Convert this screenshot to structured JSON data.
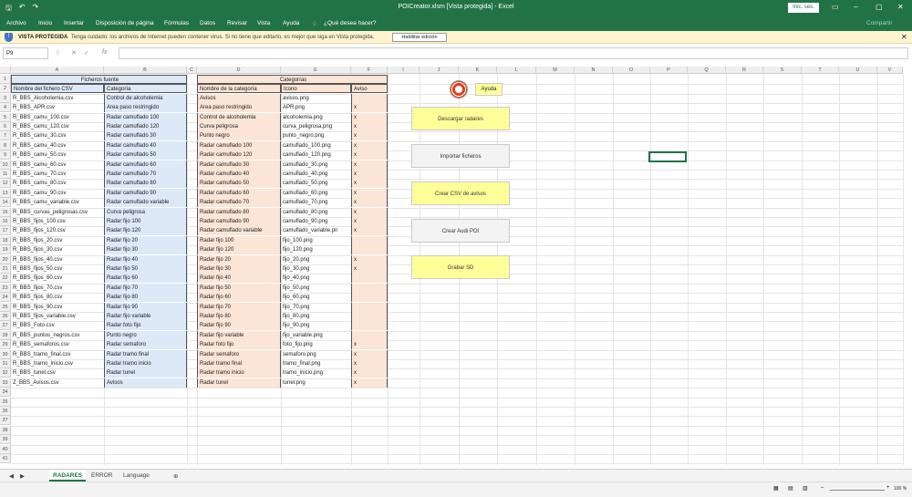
{
  "window": {
    "title": "POICreator.xlsm [Vista protegida] - Excel",
    "signin": "Inic. ses.",
    "share": "Compartir"
  },
  "ribbon_tabs": [
    "Archivo",
    "Inicio",
    "Insertar",
    "Disposición de página",
    "Fórmulas",
    "Datos",
    "Revisar",
    "Vista",
    "Ayuda",
    "¿Qué desea hacer?"
  ],
  "protected_bar": {
    "label": "VISTA PROTEGIDA",
    "message": "Tenga cuidado: los archivos de Internet pueden contener virus. Si no tiene que editarlo, es mejor que siga en Vista protegida.",
    "enable_button": "Habilitar edición"
  },
  "formula_bar": {
    "name_box": "P9",
    "fx": "fx",
    "value": ""
  },
  "columns": [
    "A",
    "B",
    "C",
    "D",
    "E",
    "F",
    "I",
    "J",
    "K",
    "L",
    "M",
    "N",
    "O",
    "P",
    "Q",
    "R",
    "S",
    "T",
    "U",
    "V"
  ],
  "rows": [
    "1",
    "2",
    "3",
    "4",
    "5",
    "6",
    "7",
    "8",
    "9",
    "10",
    "11",
    "12",
    "13",
    "14",
    "15",
    "16",
    "17",
    "18",
    "19",
    "20",
    "21",
    "22",
    "23",
    "24",
    "25",
    "26",
    "27",
    "28",
    "29",
    "30",
    "31",
    "32",
    "33",
    "34",
    "35",
    "36",
    "37",
    "38",
    "39",
    "40",
    "41"
  ],
  "table1": {
    "title": "Ficheros fuente",
    "headers": [
      "Nombre del fichero CSV",
      "Categoría"
    ],
    "rows": [
      [
        "R_BBS_Alcoholemia.csv",
        "Control de alcoholemia"
      ],
      [
        "R_BBS_APR.csv",
        "Area paso restringido"
      ],
      [
        "R_BBS_camu_100.csv",
        "Radar camuflado 100"
      ],
      [
        "R_BBS_camu_120.csv",
        "Radar camuflado 120"
      ],
      [
        "R_BBS_camu_30.csv",
        "Radar camuflado 30"
      ],
      [
        "R_BBS_camu_40.csv",
        "Radar camuflado 40"
      ],
      [
        "R_BBS_camu_50.csv",
        "Radar camuflado 50"
      ],
      [
        "R_BBS_camu_60.csv",
        "Radar camuflado 60"
      ],
      [
        "R_BBS_camu_70.csv",
        "Radar camuflado 70"
      ],
      [
        "R_BBS_camu_80.csv",
        "Radar camuflado 80"
      ],
      [
        "R_BBS_camu_90.csv",
        "Radar camuflado 90"
      ],
      [
        "R_BBS_camu_variable.csv",
        "Radar camuflado variable"
      ],
      [
        "R_BBS_curvas_peligrosas.csv",
        "Curva peligrosa"
      ],
      [
        "R_BBS_fijos_100.csv",
        "Radar fijo 100"
      ],
      [
        "R_BBS_fijos_120.csv",
        "Radar fijo 120"
      ],
      [
        "R_BBS_fijos_20.csv",
        "Radar fijo 20"
      ],
      [
        "R_BBS_fijos_30.csv",
        "Radar fijo 30"
      ],
      [
        "R_BBS_fijos_40.csv",
        "Radar fijo 40"
      ],
      [
        "R_BBS_fijos_50.csv",
        "Radar fijo 50"
      ],
      [
        "R_BBS_fijos_60.csv",
        "Radar fijo 60"
      ],
      [
        "R_BBS_fijos_70.csv",
        "Radar fijo 70"
      ],
      [
        "R_BBS_fijos_80.csv",
        "Radar fijo 80"
      ],
      [
        "R_BBS_fijos_90.csv",
        "Radar fijo 90"
      ],
      [
        "R_BBS_fijos_variable.csv",
        "Radar fijo variable"
      ],
      [
        "R_BBS_Foto.csv",
        "Radar foto fijo"
      ],
      [
        "R_BBS_puntos_negros.csv",
        "Punto negro"
      ],
      [
        "R_BBS_semaforos.csv",
        "Radar semaforo"
      ],
      [
        "R_BBS_tramo_final.csv",
        "Radar tramo final"
      ],
      [
        "R_BBS_tramo_inicio.csv",
        "Radar tramo inicio"
      ],
      [
        "R_BBS_tunel.csv",
        "Radar tunel"
      ],
      [
        "Z_BBS_Avisos.csv",
        "Avisos"
      ]
    ]
  },
  "table2": {
    "title": "Categorías",
    "headers": [
      "Nombre de la categoría",
      "Icono",
      "Aviso"
    ],
    "rows": [
      [
        "Avisos",
        "avisos.png",
        ""
      ],
      [
        "Area paso restringido",
        "APR.png",
        "x"
      ],
      [
        "Control de alcoholemia",
        "alcoholemia.png",
        "x"
      ],
      [
        "Curva peligrosa",
        "curva_peligrosa.png",
        "x"
      ],
      [
        "Punto negro",
        "punto_negro.png",
        "x"
      ],
      [
        "Radar camuflado 100",
        "camuflado_100.png",
        "x"
      ],
      [
        "Radar camuflado 120",
        "camuflado_120.png",
        "x"
      ],
      [
        "Radar camuflado 30",
        "camuflado_30.png",
        "x"
      ],
      [
        "Radar camuflado 40",
        "camuflado_40.png",
        "x"
      ],
      [
        "Radar camuflado 50",
        "camuflado_50.png",
        "x"
      ],
      [
        "Radar camuflado 60",
        "camuflado_60.png",
        "x"
      ],
      [
        "Radar camuflado 70",
        "camuflado_70.png",
        "x"
      ],
      [
        "Radar camuflado 80",
        "camuflado_80.png",
        "x"
      ],
      [
        "Radar camuflado 90",
        "camuflado_90.png",
        "x"
      ],
      [
        "Radar camuflado variable",
        "camuflado_variable.pn",
        "x"
      ],
      [
        "Radar fijo 100",
        "fijo_100.png",
        ""
      ],
      [
        "Radar fijo 120",
        "fijo_120.png",
        ""
      ],
      [
        "Radar fijo 20",
        "fijo_20.png",
        "x"
      ],
      [
        "Radar fijo 30",
        "fijo_30.png",
        "x"
      ],
      [
        "Radar fijo 40",
        "fijo_40.png",
        ""
      ],
      [
        "Radar fijo 50",
        "fijo_50.png",
        ""
      ],
      [
        "Radar fijo 60",
        "fijo_60.png",
        ""
      ],
      [
        "Radar fijo 70",
        "fijo_70.png",
        ""
      ],
      [
        "Radar fijo 80",
        "fijo_80.png",
        ""
      ],
      [
        "Radar fijo 90",
        "fijo_90.png",
        ""
      ],
      [
        "Radar fijo variable",
        "fijo_variable.png",
        ""
      ],
      [
        "Radar foto fijo",
        "foto_fijo.png",
        "x"
      ],
      [
        "Radar semaforo",
        "semaforo.png",
        "x"
      ],
      [
        "Radar tramo final",
        "tramo_final.png",
        "x"
      ],
      [
        "Radar tramo inicio",
        "tramo_inicio.png",
        "x"
      ],
      [
        "Radar tunel",
        "tunel.png",
        "x"
      ]
    ]
  },
  "buttons": {
    "help": "Ayuda",
    "download": "Descargar radares",
    "import": "Importar ficheros",
    "csv": "Crear CSV de avisos",
    "audi": "Crear Audi POI",
    "sd": "Grabar SD"
  },
  "sheets": [
    "RADARES",
    "ERROR",
    "Language"
  ],
  "status": {
    "zoom": "100 %"
  },
  "colors": {
    "excel_green": "#217346",
    "header_fill": "#fbe5d6",
    "blue_fill": "#dde9f7",
    "button_yellow": "#ffff99"
  }
}
